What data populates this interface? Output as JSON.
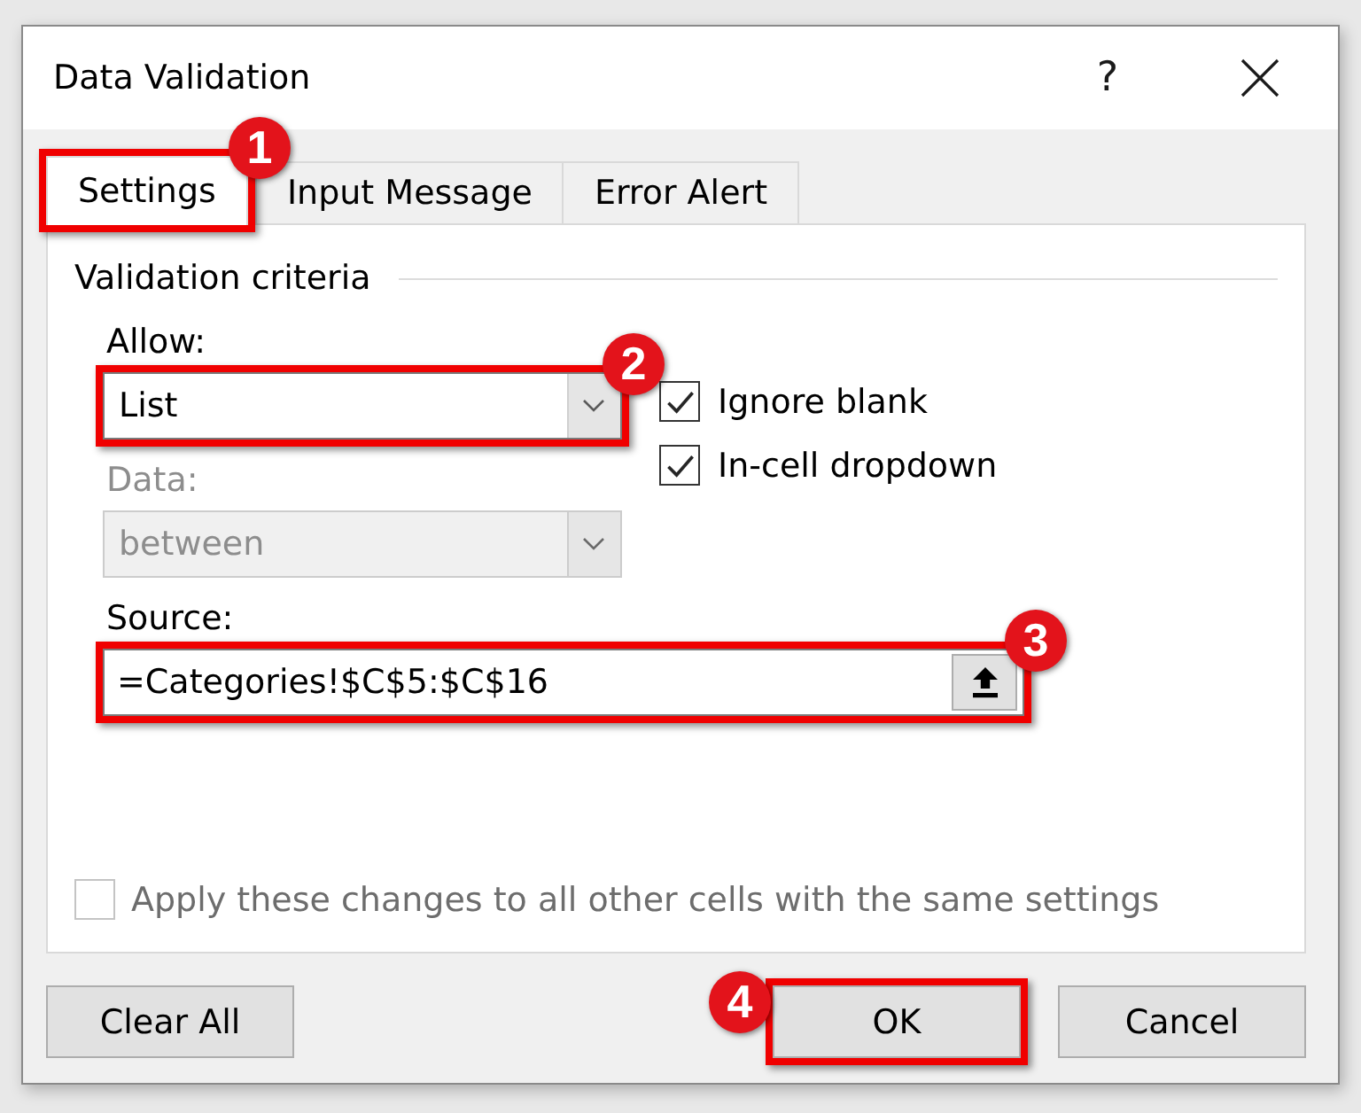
{
  "window": {
    "title": "Data Validation",
    "help_button": "?"
  },
  "tabs": [
    {
      "label": "Settings",
      "selected": true,
      "callout": {
        "number": "1",
        "kind": "right"
      }
    },
    {
      "label": "Input Message",
      "selected": false
    },
    {
      "label": "Error Alert",
      "selected": false
    }
  ],
  "validation_criteria": {
    "title": "Validation criteria",
    "allow": {
      "label": "Allow:",
      "value": "List",
      "disabled": false,
      "callout": {
        "number": "2",
        "kind": "right"
      }
    },
    "data": {
      "label": "Data:",
      "value": "between",
      "disabled": true
    },
    "options": [
      {
        "label": "Ignore blank",
        "checked": true
      },
      {
        "label": "In-cell dropdown",
        "checked": true
      }
    ],
    "source": {
      "label": "Source:",
      "value": "=Categories!$C$5:$C$16",
      "callout": {
        "number": "3",
        "kind": "right"
      }
    }
  },
  "apply_to_all": {
    "label": "Apply these changes to all other cells with the same settings",
    "checked": false,
    "disabled": true
  },
  "buttons": [
    {
      "label": "Clear All"
    },
    {
      "label": "OK",
      "callout": {
        "number": "4",
        "kind": "left"
      }
    },
    {
      "label": "Cancel"
    }
  ]
}
